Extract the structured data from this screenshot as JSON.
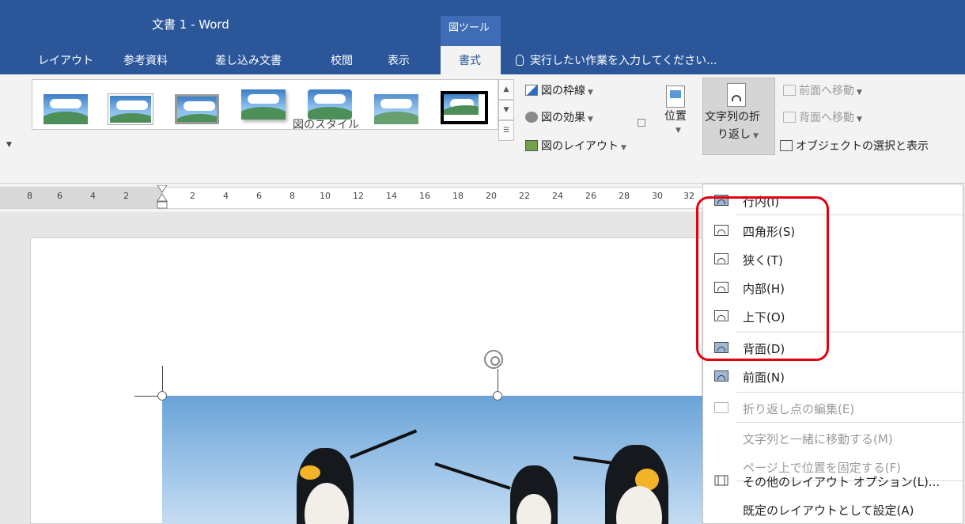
{
  "window": {
    "doc_title": "文書 1 - Word",
    "context_tab_group": "図ツール"
  },
  "tabs": [
    {
      "label": "レイアウト"
    },
    {
      "label": "参考資料"
    },
    {
      "label": "差し込み文書"
    },
    {
      "label": "校閲"
    },
    {
      "label": "表示"
    },
    {
      "label": "書式"
    }
  ],
  "tell_me": "実行したい作業を入力してください...",
  "ribbon": {
    "picture_styles_group_label": "図のスタイル",
    "border_label": "図の枠線",
    "effects_label": "図の効果",
    "layout_label": "図のレイアウト",
    "position_label": "位置",
    "wrap_text_label_line1": "文字列の折",
    "wrap_text_label_line2": "り返し",
    "bring_forward_label": "前面へ移動",
    "send_backward_label": "背面へ移動",
    "selection_pane_label": "オブジェクトの選択と表示"
  },
  "ruler": {
    "ticks": [
      "8",
      "6",
      "4",
      "2",
      "2",
      "4",
      "6",
      "8",
      "10",
      "12",
      "14",
      "16",
      "18",
      "20",
      "22",
      "24",
      "26",
      "28",
      "30",
      "32"
    ]
  },
  "wrap_menu": {
    "items": [
      {
        "label": "行内(I)",
        "enabled": true
      },
      {
        "label": "四角形(S)",
        "enabled": true
      },
      {
        "label": "狭く(T)",
        "enabled": true
      },
      {
        "label": "内部(H)",
        "enabled": true
      },
      {
        "label": "上下(O)",
        "enabled": true
      },
      {
        "label": "背面(D)",
        "enabled": true
      },
      {
        "label": "前面(N)",
        "enabled": true
      },
      {
        "label": "折り返し点の編集(E)",
        "enabled": false
      },
      {
        "label": "文字列と一緒に移動する(M)",
        "enabled": false
      },
      {
        "label": "ページ上で位置を固定する(F)",
        "enabled": false
      },
      {
        "label": "その他のレイアウト オプション(L)...",
        "enabled": true
      },
      {
        "label": "既定のレイアウトとして設定(A)",
        "enabled": true
      }
    ]
  },
  "colors": {
    "title_bar": "#2b579a",
    "highlight": "#e3000f"
  }
}
